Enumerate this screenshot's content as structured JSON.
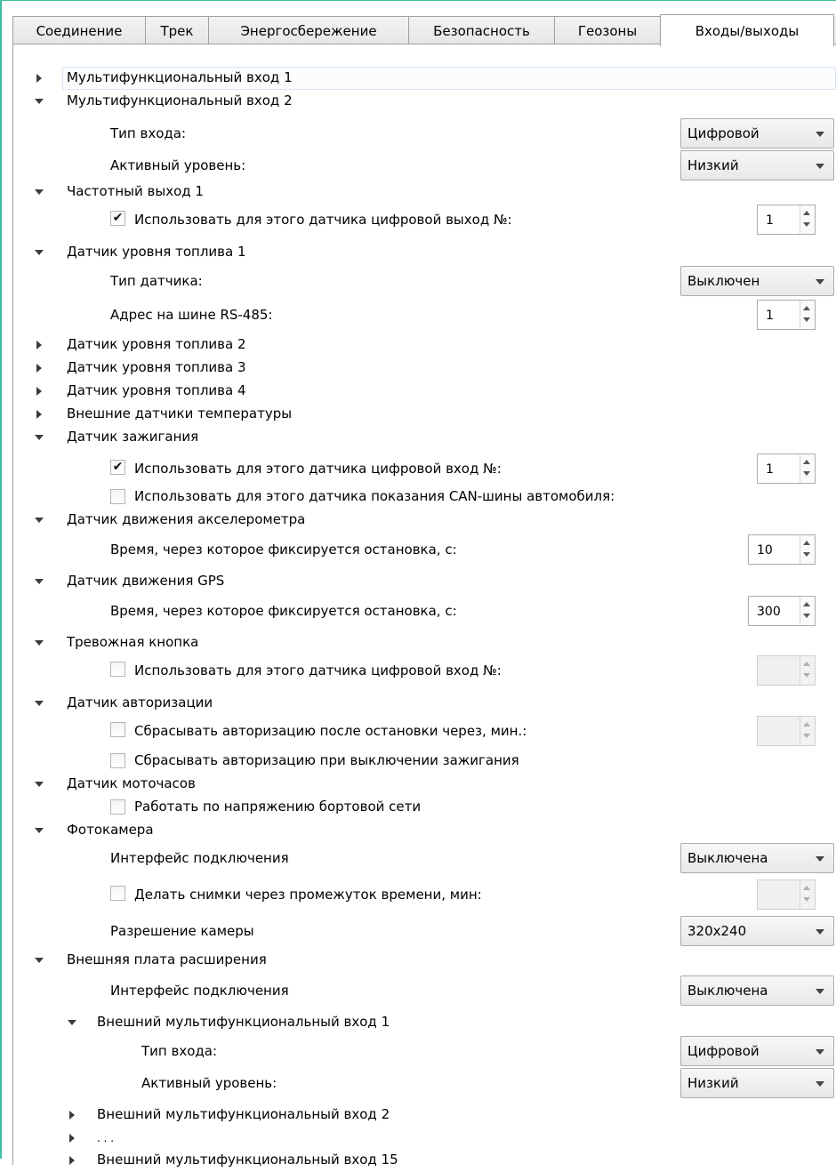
{
  "tabs": [
    {
      "label": "Соединение"
    },
    {
      "label": "Трек"
    },
    {
      "label": "Энергосбережение"
    },
    {
      "label": "Безопасность"
    },
    {
      "label": "Геозоны"
    },
    {
      "label": "Входы/выходы"
    }
  ],
  "active_tab": "Входы/выходы",
  "tree": {
    "mfi1": {
      "label": "Мультифункциональный вход 1"
    },
    "mfi2": {
      "label": "Мультифункциональный вход 2",
      "input_type_label": "Тип входа:",
      "input_type_value": "Цифровой",
      "active_level_label": "Активный уровень:",
      "active_level_value": "Низкий"
    },
    "freq_out1": {
      "label": "Частотный выход 1",
      "use_label": "Использовать для этого датчика цифровой выход №:",
      "use_checked": "✔",
      "use_value": "1"
    },
    "fuel1": {
      "label": "Датчик уровня топлива 1",
      "type_label": "Тип датчика:",
      "type_value": "Выключен",
      "address_label": "Адрес на шине RS-485:",
      "address_value": "1"
    },
    "fuel2": {
      "label": "Датчик уровня топлива 2"
    },
    "fuel3": {
      "label": "Датчик уровня топлива 3"
    },
    "fuel4": {
      "label": "Датчик уровня топлива 4"
    },
    "ext_temp": {
      "label": "Внешние датчики температуры"
    },
    "ignition": {
      "label": "Датчик зажигания",
      "use_digital_label": "Использовать для этого датчика цифровой вход №:",
      "use_digital_checked": "✔",
      "use_digital_value": "1",
      "use_can_label": "Использовать для этого датчика показания CAN-шины автомобиля:"
    },
    "accel_motion": {
      "label": "Датчик движения акселерометра",
      "stop_time_label": "Время, через которое фиксируется остановка, с:",
      "stop_time_value": "10"
    },
    "gps_motion": {
      "label": "Датчик движения GPS",
      "stop_time_label": "Время, через которое фиксируется остановка, с:",
      "stop_time_value": "300"
    },
    "panic": {
      "label": "Тревожная кнопка",
      "use_label": "Использовать для этого датчика цифровой вход №:"
    },
    "auth": {
      "label": "Датчик авторизации",
      "reset_after_stop_label": "Сбрасывать авторизацию после остановки через, мин.:",
      "reset_on_ignition_label": "Сбрасывать авторизацию при выключении зажигания"
    },
    "engine_hours": {
      "label": "Датчик моточасов",
      "voltage_label": "Работать по напряжению бортовой сети"
    },
    "camera": {
      "label": "Фотокамера",
      "interface_label": "Интерфейс подключения",
      "interface_value": "Выключена",
      "interval_label": "Делать снимки через промежуток времени, мин:",
      "resolution_label": "Разрешение камеры",
      "resolution_value": "320x240"
    },
    "ext_board": {
      "label": "Внешняя плата расширения",
      "interface_label": "Интерфейс подключения",
      "interface_value": "Выключена",
      "ext_mfi1": {
        "label": "Внешний мультифункциональный вход 1",
        "input_type_label": "Тип входа:",
        "input_type_value": "Цифровой",
        "active_level_label": "Активный уровень:",
        "active_level_value": "Низкий"
      },
      "ext_mfi2": {
        "label": "Внешний мультифункциональный вход 2"
      },
      "ellipsis": ". . .",
      "ext_mfi15": {
        "label": "Внешний мультифункциональный вход 15"
      }
    }
  }
}
